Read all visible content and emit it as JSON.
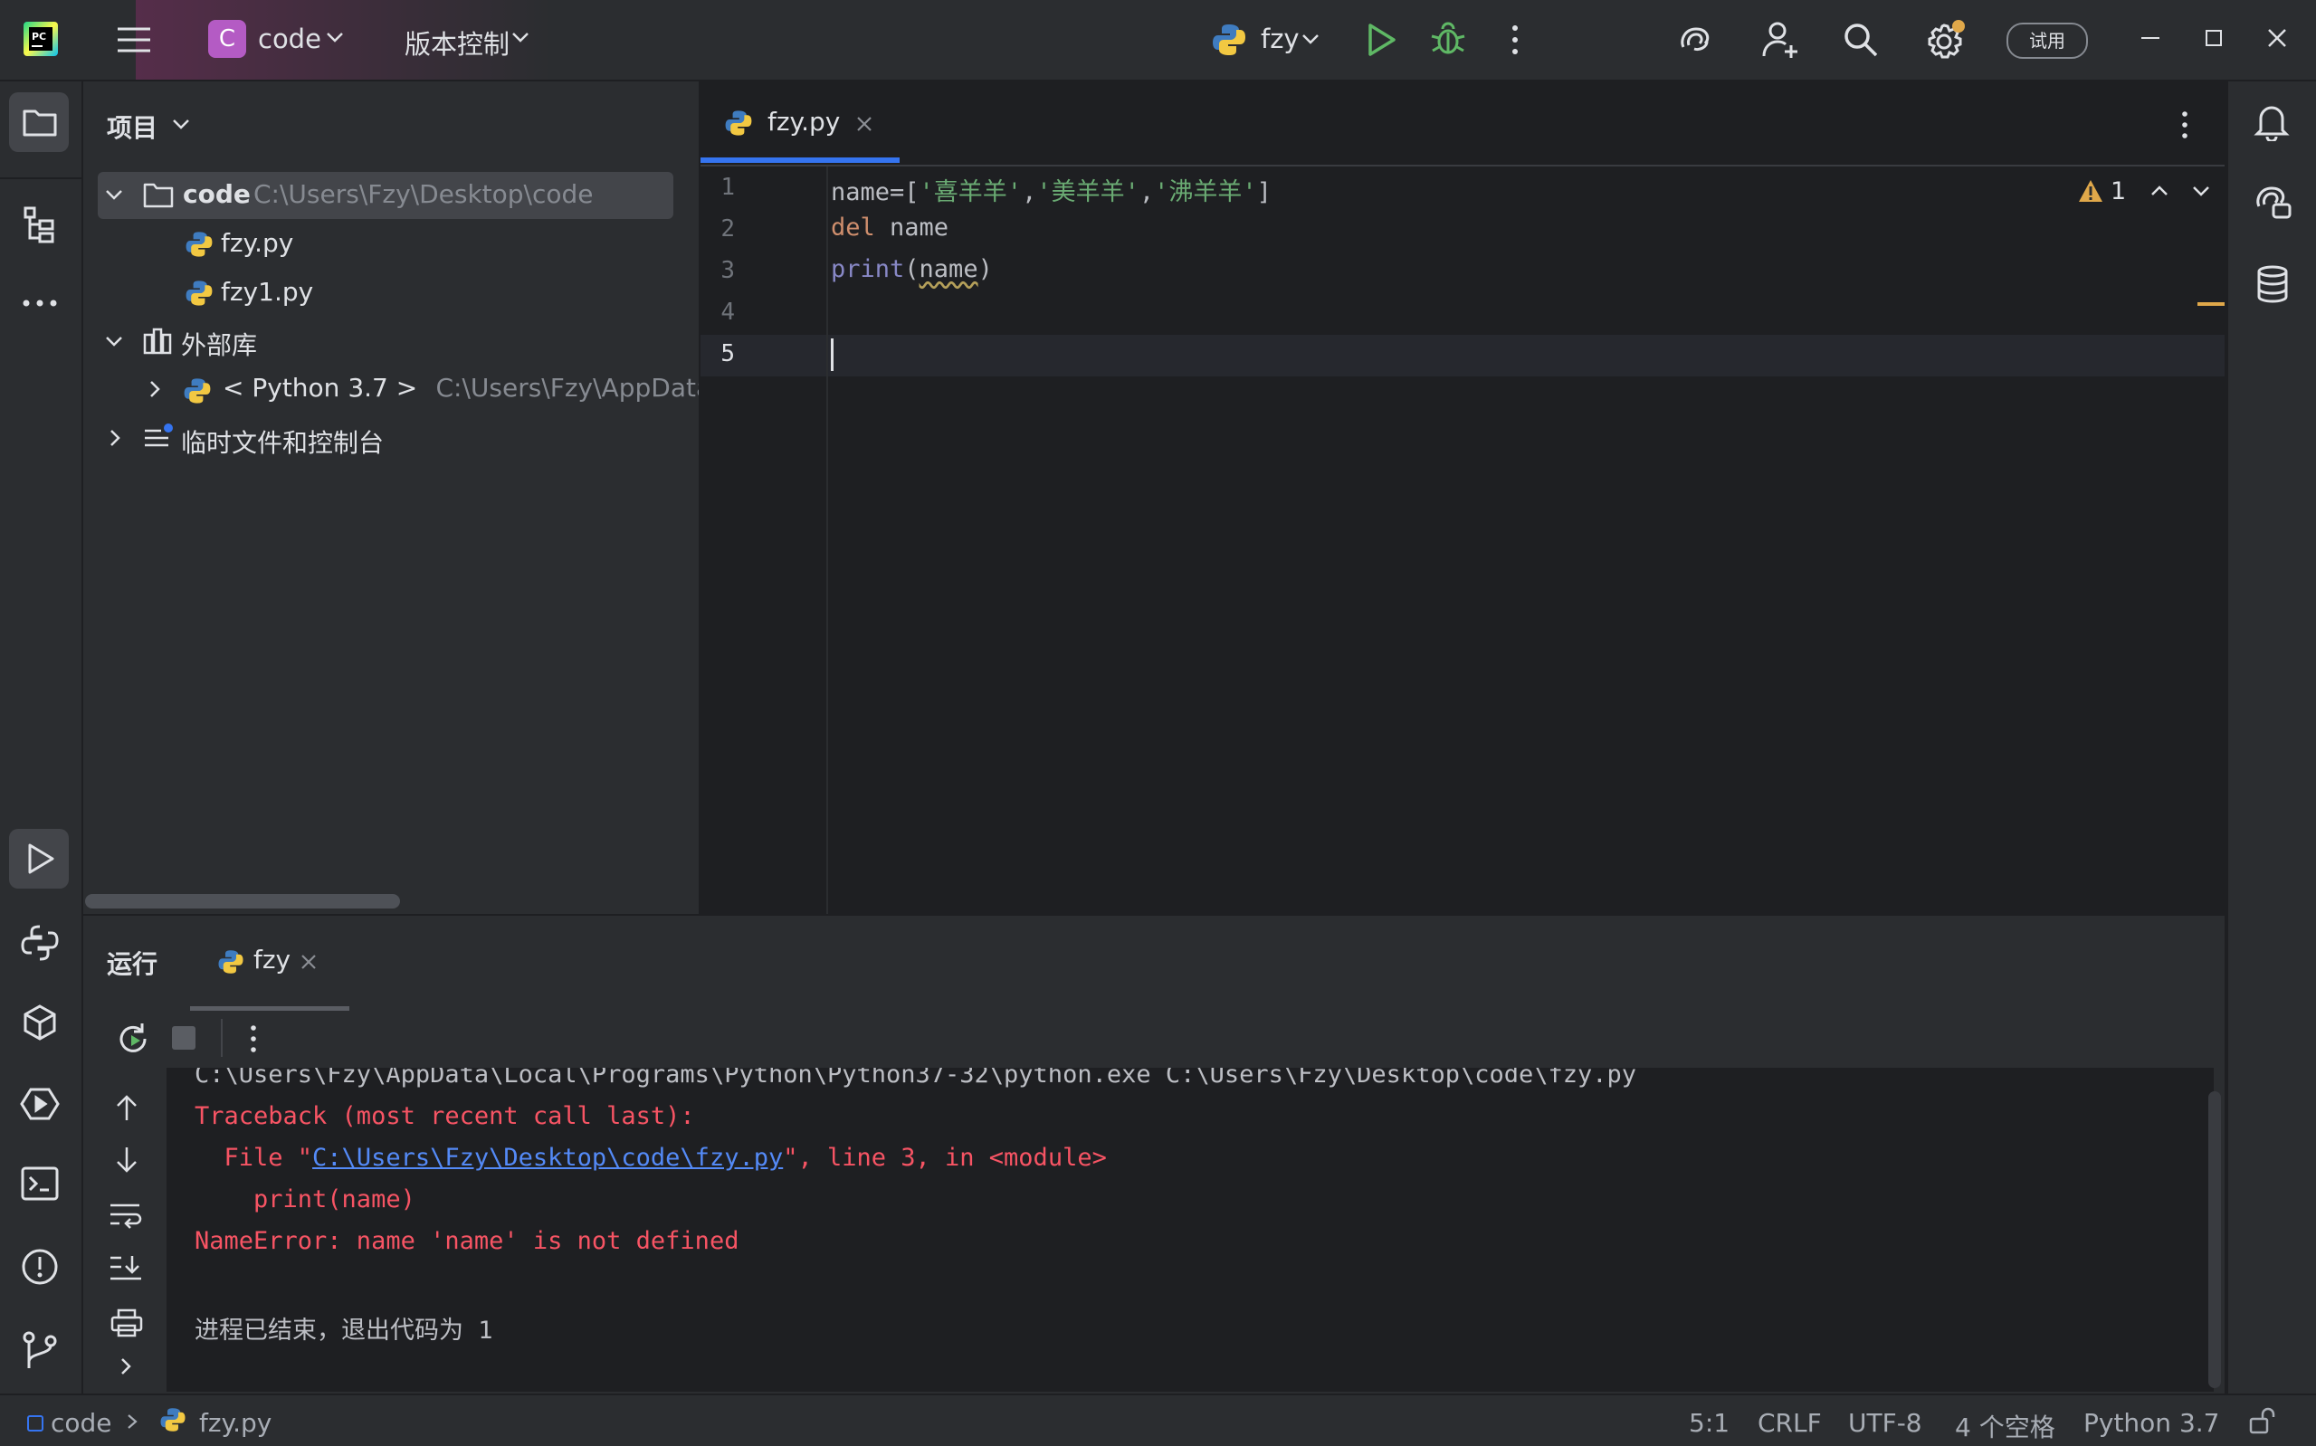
{
  "titlebar": {
    "project_badge": "C",
    "project_name": "code",
    "vcs_label": "版本控制",
    "run_config": "fzy",
    "trial_label": "试用"
  },
  "project_panel": {
    "title": "项目",
    "tree": {
      "root_name": "code",
      "root_path": "C:\\Users\\Fzy\\Desktop\\code",
      "files": [
        "fzy.py",
        "fzy1.py"
      ],
      "external_libs": "外部库",
      "python_sdk": "< Python 3.7 >",
      "python_sdk_path": "C:\\Users\\Fzy\\AppData\\Lo",
      "scratches": "临时文件和控制台"
    }
  },
  "editor": {
    "tab_label": "fzy.py",
    "warning_count": "1",
    "line_numbers": [
      "1",
      "2",
      "3",
      "4",
      "5"
    ],
    "code": {
      "line1_prefix": "name=[",
      "line1_s1": "'喜羊羊'",
      "line1_comma1": ",",
      "line1_s2": "'美羊羊'",
      "line1_comma2": ",",
      "line1_s3": "'沸羊羊'",
      "line1_suffix": "]",
      "line2_kw": "del",
      "line2_rest": " name",
      "line3_fn": "print",
      "line3_open": "(",
      "line3_arg": "name",
      "line3_close": ")"
    }
  },
  "run_panel": {
    "title": "运行",
    "tab_label": "fzy",
    "console": {
      "cmd_line": "C:\\Users\\Fzy\\AppData\\Local\\Programs\\Python\\Python37-32\\python.exe C:\\Users\\Fzy\\Desktop\\code\\fzy.py",
      "traceback": "Traceback (most recent call last):",
      "file_prefix": "  File \"",
      "file_link": "C:\\Users\\Fzy\\Desktop\\code\\fzy.py",
      "file_suffix": "\", line 3, in <module>",
      "source_line": "    print(name)",
      "error": "NameError: name 'name' is not defined",
      "exit_msg": "进程已结束，退出代码为 1"
    }
  },
  "statusbar": {
    "breadcrumb_project": "code",
    "breadcrumb_file": "fzy.py",
    "position": "5:1",
    "line_sep": "CRLF",
    "encoding": "UTF-8",
    "indent": "4 个空格",
    "interpreter": "Python 3.7"
  },
  "colors": {
    "background": "#1e1f22",
    "panel": "#2b2d30",
    "keyword": "#cf8e6d",
    "string": "#6aab73",
    "builtin": "#8888c6",
    "error": "#f75464",
    "link": "#548af7",
    "accent": "#3574f0",
    "run_green": "#5fb865",
    "warning": "#e0a84a"
  }
}
